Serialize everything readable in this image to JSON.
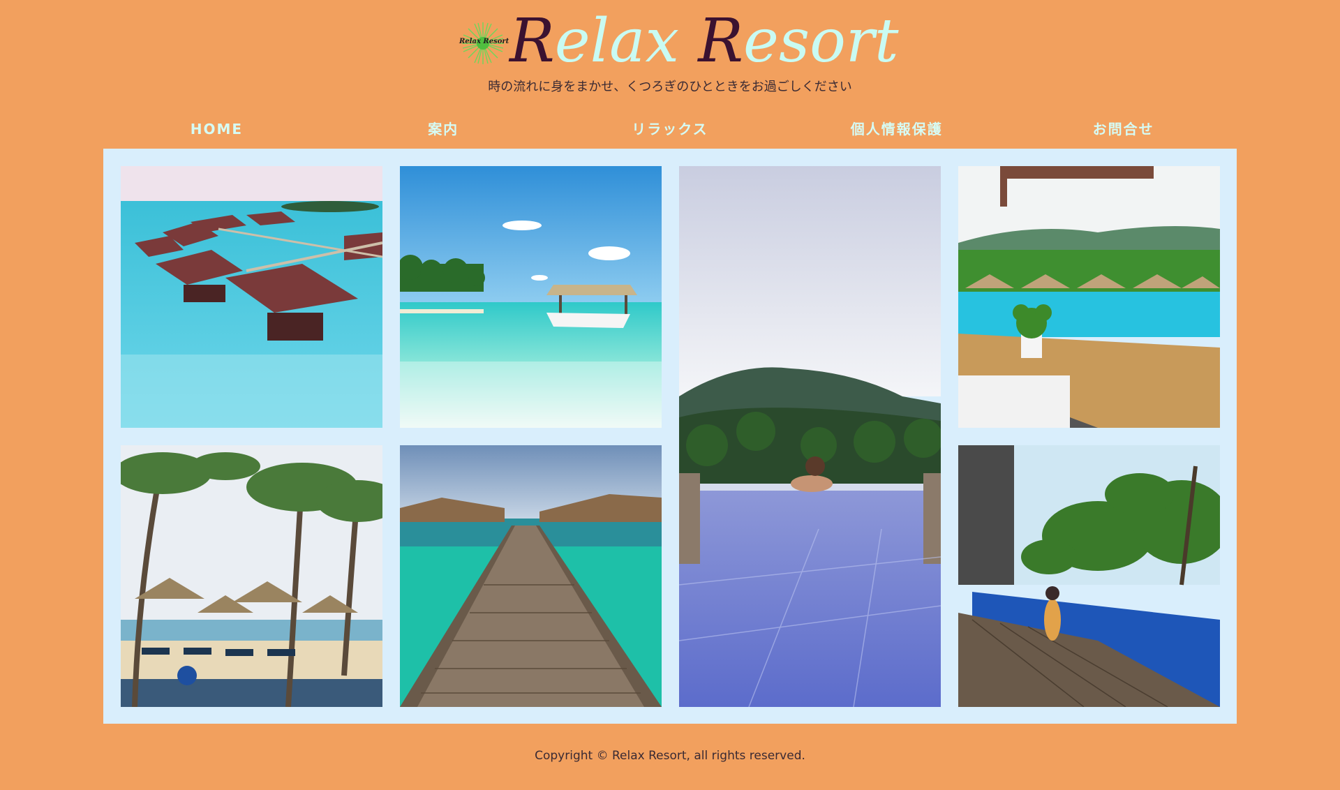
{
  "brand": {
    "badge_text": "Relax Resort",
    "name_r1": "R",
    "name_p1": "elax ",
    "name_r2": "R",
    "name_p2": "esort",
    "tagline": "時の流れに身をまかせ、くつろぎのひとときをお過ごしください"
  },
  "nav": {
    "items": [
      "HOME",
      "案内",
      "リラックス",
      "個人情報保護",
      "お問合せ"
    ]
  },
  "gallery": {
    "photos": [
      {
        "subject": "overwater-villas"
      },
      {
        "subject": "beach-boat"
      },
      {
        "subject": "infinity-pool-mountains"
      },
      {
        "subject": "pool-terrace"
      },
      {
        "subject": "palm-beach-umbrellas"
      },
      {
        "subject": "wooden-pier"
      },
      {
        "subject": "poolside-relax"
      }
    ]
  },
  "footer": {
    "copyright": "Copyright © Relax Resort, all rights reserved."
  },
  "colors": {
    "background": "#f2a05e",
    "gallery_bg": "#d9eefc",
    "brand_dark": "#3b1230",
    "brand_light": "#c9fbf3",
    "nav_text": "#d6fbf4"
  }
}
